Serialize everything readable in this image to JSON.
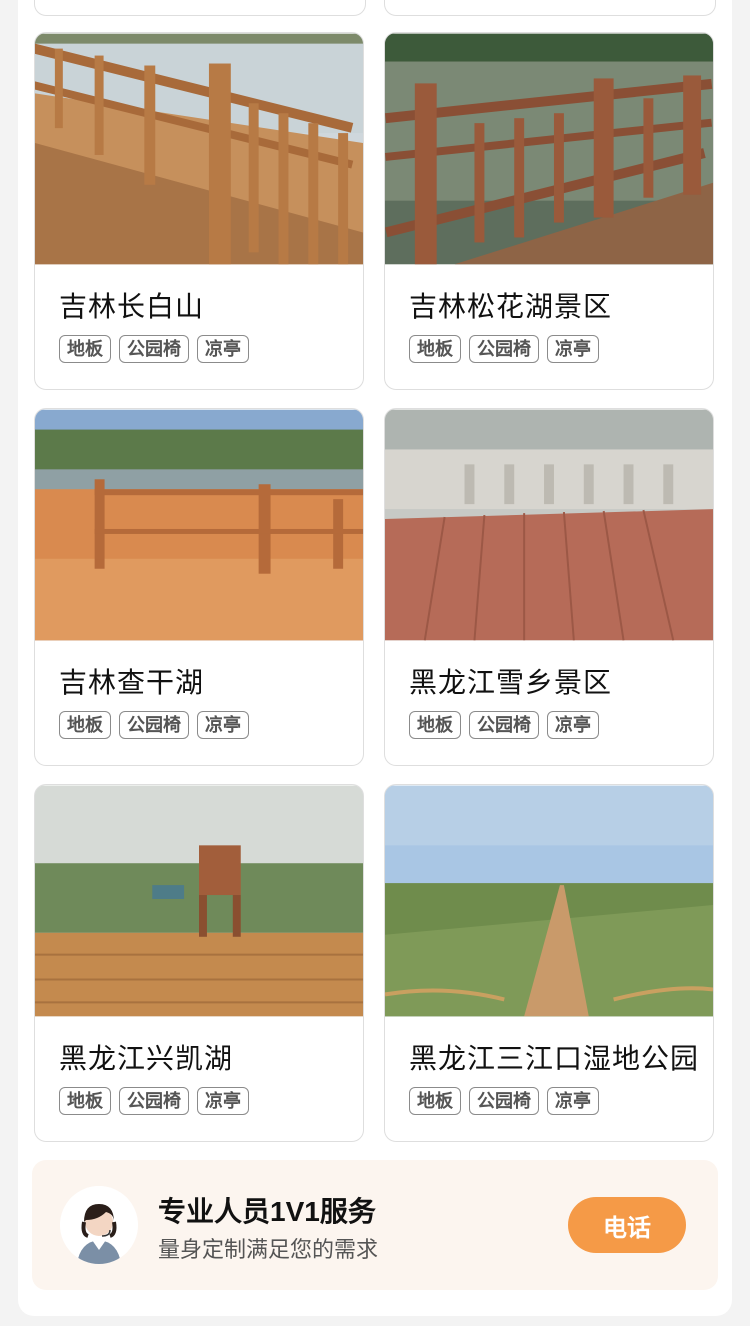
{
  "projects": [
    {
      "name": "吉林长白山",
      "tags": [
        "地板",
        "公园椅",
        "凉亭"
      ]
    },
    {
      "name": "吉林松花湖景区",
      "tags": [
        "地板",
        "公园椅",
        "凉亭"
      ]
    },
    {
      "name": "吉林查干湖",
      "tags": [
        "地板",
        "公园椅",
        "凉亭"
      ]
    },
    {
      "name": "黑龙江雪乡景区",
      "tags": [
        "地板",
        "公园椅",
        "凉亭"
      ]
    },
    {
      "name": "黑龙江兴凯湖",
      "tags": [
        "地板",
        "公园椅",
        "凉亭"
      ]
    },
    {
      "name": "黑龙江三江口湿地公园",
      "tags": [
        "地板",
        "公园椅",
        "凉亭"
      ]
    }
  ],
  "service": {
    "title": "专业人员1V1服务",
    "subtitle": "量身定制满足您的需求",
    "call_label": "电话",
    "avatar_icon": "customer-service-agent-icon"
  },
  "colors": {
    "accent": "#f59a47",
    "service_bg": "#fcf5ef"
  }
}
